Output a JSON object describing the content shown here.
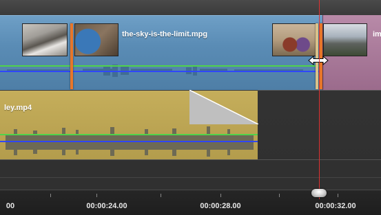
{
  "video_track": {
    "clip_title": "the-sky-is-the-limit.mpg",
    "next_clip_title_partial": "im"
  },
  "audio_track": {
    "clip_title_partial": "ley.mp4"
  },
  "ruler": {
    "labels": [
      "00",
      "00:00:24.00",
      "00:00:28.00",
      "00:00:32.00"
    ]
  },
  "colors": {
    "video_clip": "#5a8cb5",
    "next_video_clip": "#9b6b8c",
    "audio_clip": "#b8a04f",
    "trim_marker": "#e8762a",
    "playhead": "#e03131",
    "volume_line": "#4fd34a",
    "pan_line": "#2f46ff"
  },
  "icons": [
    "resize-cursor-icon",
    "scrubber-knob-icon",
    "fade-triangle-icon"
  ]
}
